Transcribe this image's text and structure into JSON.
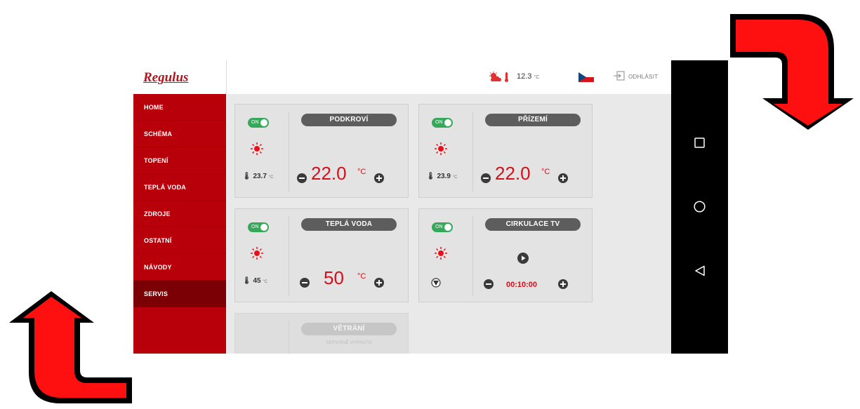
{
  "header": {
    "logo": "Regulus",
    "weather_icon": "weather-cloud-sun-icon",
    "outdoor_temp": "12.3",
    "outdoor_temp_unit": "°C",
    "flag_icon": "czech-flag-icon",
    "logout_label": "ODHLÁSIT"
  },
  "sidebar": {
    "items": [
      {
        "label": "HOME"
      },
      {
        "label": "SCHÉMA"
      },
      {
        "label": "TOPENÍ"
      },
      {
        "label": "TEPLÁ VODA"
      },
      {
        "label": "ZDROJE"
      },
      {
        "label": "OSTATNÍ"
      },
      {
        "label": "NÁVODY"
      },
      {
        "label": "SERVIS",
        "active": true
      }
    ]
  },
  "cards": {
    "podkrovi": {
      "title": "PODKROVÍ",
      "toggle": "ON",
      "current": "23.7",
      "current_unit": "°C",
      "setpoint": "22.0",
      "setpoint_unit": "°C"
    },
    "prizemi": {
      "title": "PŘÍZEMÍ",
      "toggle": "ON",
      "current": "23.9",
      "current_unit": "°C",
      "setpoint": "22.0",
      "setpoint_unit": "°C"
    },
    "tepla_voda": {
      "title": "TEPLÁ VODA",
      "toggle": "ON",
      "current": "45",
      "current_unit": "°C",
      "setpoint": "50",
      "setpoint_unit": "°C"
    },
    "cirkulace": {
      "title": "CIRKULACE TV",
      "toggle": "ON",
      "timer": "00:10:00"
    },
    "vetrani": {
      "title": "VĚTRÁNÍ",
      "note": "SERVISNĚ VYPNUTO"
    }
  },
  "android_nav": {
    "icons": [
      "recent-apps-icon",
      "home-circle-icon",
      "back-triangle-icon"
    ]
  },
  "colors": {
    "brand_red": "#b8000a",
    "accent_red": "#d3101b",
    "toggle_green": "#36a85a",
    "arrow_red": "#ff0000"
  }
}
